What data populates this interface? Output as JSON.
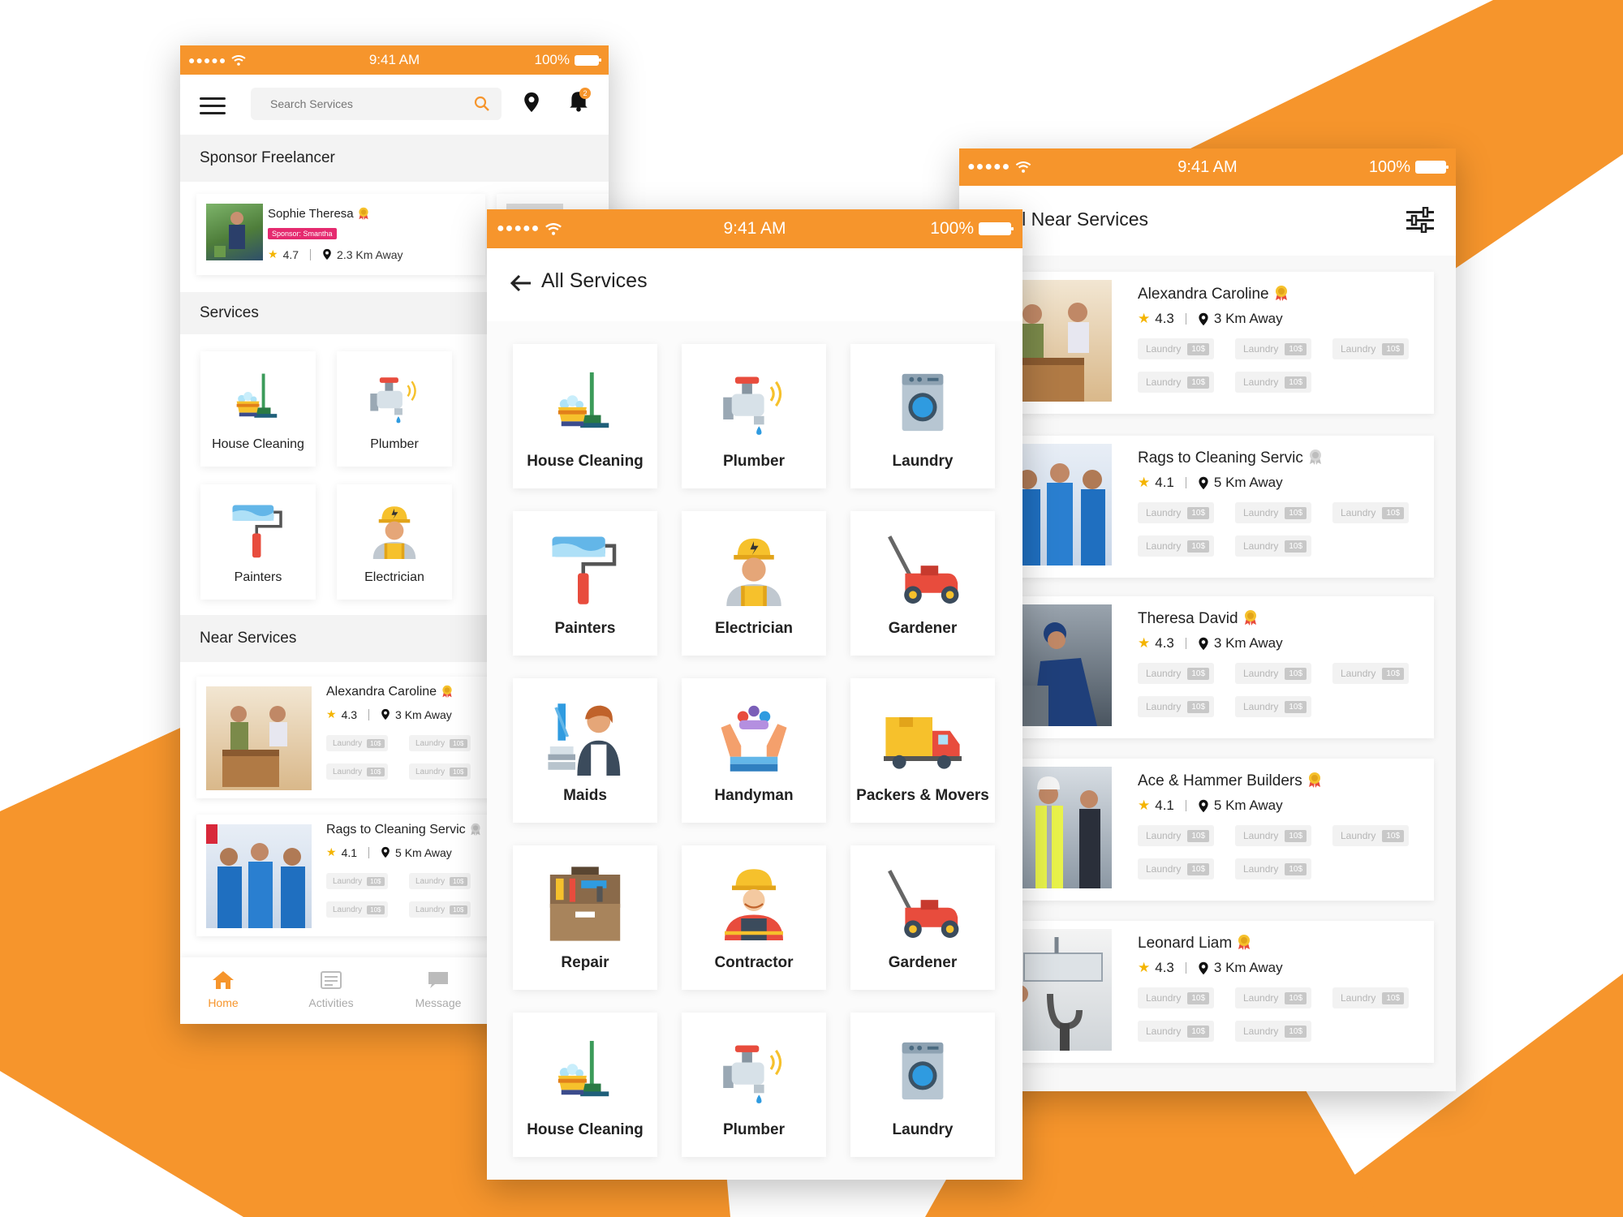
{
  "colors": {
    "accent": "#f6952c",
    "sponsor_badge": "#e52a6f",
    "star": "#f4b400"
  },
  "home_screen": {
    "status": {
      "time": "9:41 AM",
      "battery": "100%"
    },
    "search": {
      "placeholder": "Search Services"
    },
    "notification_count": "2",
    "sponsor_title": "Sponsor Freelancer",
    "sponsor": {
      "name": "Sophie Theresa",
      "badge": "Sponsor: Smantha",
      "rating": "4.7",
      "distance": "2.3 Km Away"
    },
    "services_title": "Services",
    "services": [
      {
        "label": "House Cleaning",
        "icon": "house-cleaning-icon"
      },
      {
        "label": "Plumber",
        "icon": "plumber-icon"
      },
      {
        "label": "Painters",
        "icon": "painters-icon"
      },
      {
        "label": "Electrician",
        "icon": "electrician-icon"
      }
    ],
    "near_title": "Near Services",
    "near": [
      {
        "name": "Alexandra Caroline",
        "rating": "4.3",
        "distance": "3 Km Away"
      },
      {
        "name": "Rags to  Cleaning Servic",
        "rating": "4.1",
        "distance": "5 Km Away"
      }
    ],
    "chip": {
      "label": "Laundry",
      "price": "10$"
    },
    "nav": [
      {
        "label": "Home",
        "icon": "home-icon"
      },
      {
        "label": "Activities",
        "icon": "activities-icon"
      },
      {
        "label": "Message",
        "icon": "message-icon"
      }
    ]
  },
  "all_services_screen": {
    "status": {
      "time": "9:41 AM",
      "battery": "100%"
    },
    "title": "All Services",
    "tiles": [
      {
        "label": "House Cleaning",
        "icon": "house-cleaning-icon"
      },
      {
        "label": "Plumber",
        "icon": "plumber-icon"
      },
      {
        "label": "Laundry",
        "icon": "laundry-icon"
      },
      {
        "label": "Painters",
        "icon": "painters-icon"
      },
      {
        "label": "Electrician",
        "icon": "electrician-icon"
      },
      {
        "label": "Gardener",
        "icon": "gardener-icon"
      },
      {
        "label": "Maids",
        "icon": "maids-icon"
      },
      {
        "label": "Handyman",
        "icon": "handyman-icon"
      },
      {
        "label": "Packers & Movers",
        "icon": "packers-movers-icon"
      },
      {
        "label": "Repair",
        "icon": "repair-icon"
      },
      {
        "label": "Contractor",
        "icon": "contractor-icon"
      },
      {
        "label": "Gardener",
        "icon": "gardener-icon"
      },
      {
        "label": "House Cleaning",
        "icon": "house-cleaning-icon"
      },
      {
        "label": "Plumber",
        "icon": "plumber-icon"
      },
      {
        "label": "Laundry",
        "icon": "laundry-icon"
      }
    ]
  },
  "near_services_screen": {
    "status": {
      "time": "9:41 AM",
      "battery": "100%"
    },
    "title": "ll Near Services",
    "chip": {
      "label": "Laundry",
      "price": "10$"
    },
    "providers": [
      {
        "name": "Alexandra Caroline",
        "rating": "4.3",
        "distance": "3 Km Away"
      },
      {
        "name": "Rags to  Cleaning Servic",
        "rating": "4.1",
        "distance": "5 Km Away"
      },
      {
        "name": "Theresa David",
        "rating": "4.3",
        "distance": "3 Km Away"
      },
      {
        "name": "Ace & Hammer Builders",
        "rating": "4.1",
        "distance": "5 Km Away"
      },
      {
        "name": "Leonard Liam",
        "rating": "4.3",
        "distance": "3 Km Away"
      }
    ]
  }
}
